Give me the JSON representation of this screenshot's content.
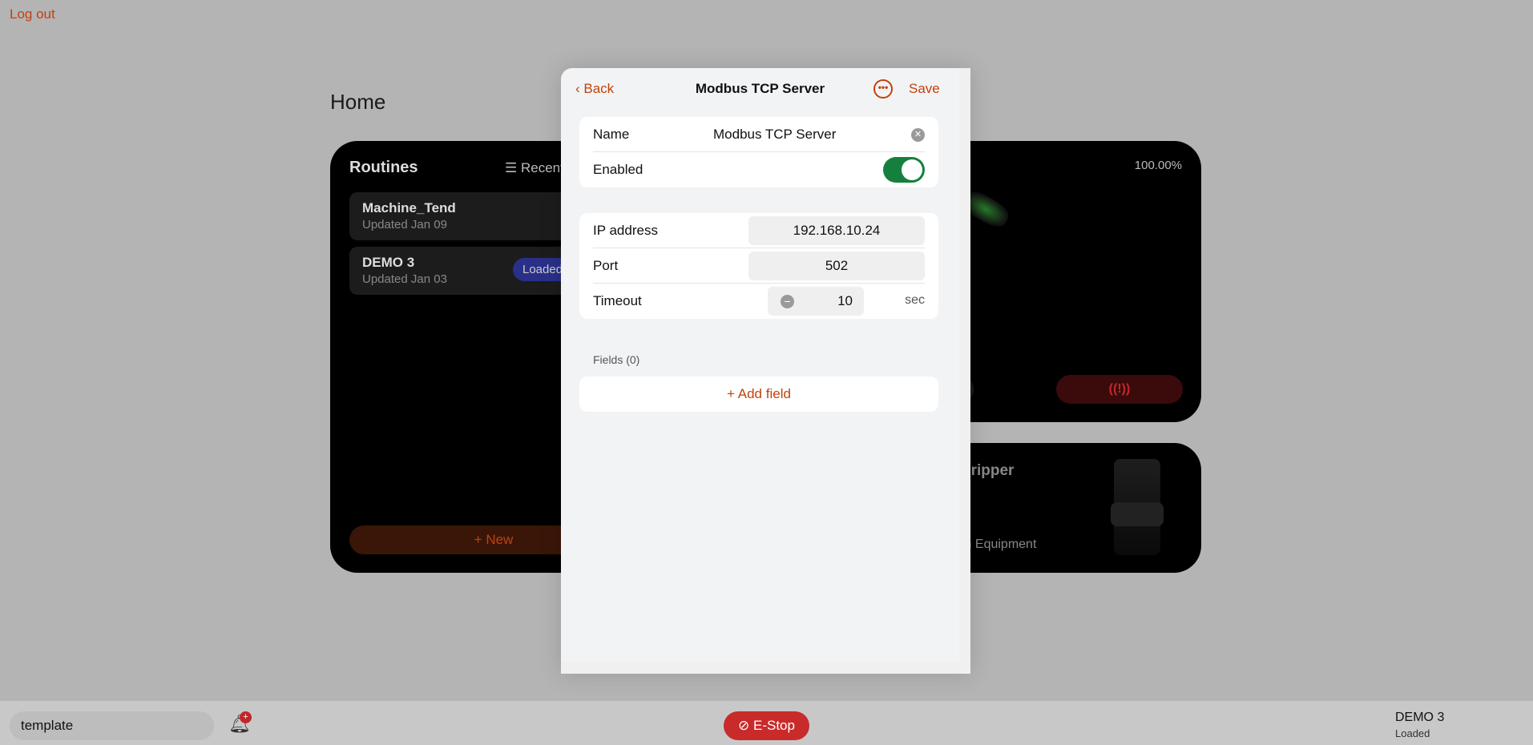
{
  "top": {
    "logout": "Log out",
    "home_title": "Home"
  },
  "routines": {
    "title": "Routines",
    "sort": "Recent",
    "items": [
      {
        "name": "Machine_Tend",
        "updated": "Updated Jan 09"
      },
      {
        "name": "DEMO 3",
        "updated": "Updated Jan 03",
        "badge": "Loaded"
      }
    ],
    "new_label": "New"
  },
  "robot": {
    "speed": "100.00%"
  },
  "gripper": {
    "title": "gripper",
    "subtitle": "in Equipment"
  },
  "modal": {
    "back": "Back",
    "title": "Modbus TCP Server",
    "save": "Save",
    "name_label": "Name",
    "name_value": "Modbus TCP Server",
    "enabled_label": "Enabled",
    "enabled": true,
    "ip_label": "IP address",
    "ip_value": "192.168.10.24",
    "port_label": "Port",
    "port_value": "502",
    "timeout_label": "Timeout",
    "timeout_value": "10",
    "timeout_unit": "sec",
    "fields_label": "Fields (0)",
    "add_field": "Add field"
  },
  "bottom": {
    "template": "template",
    "estop": "E-Stop",
    "routine_name": "DEMO 3",
    "routine_status": "Loaded"
  },
  "colors": {
    "accent": "#c2410c",
    "toggle_on": "#15803d",
    "estop": "#c92a2a"
  }
}
